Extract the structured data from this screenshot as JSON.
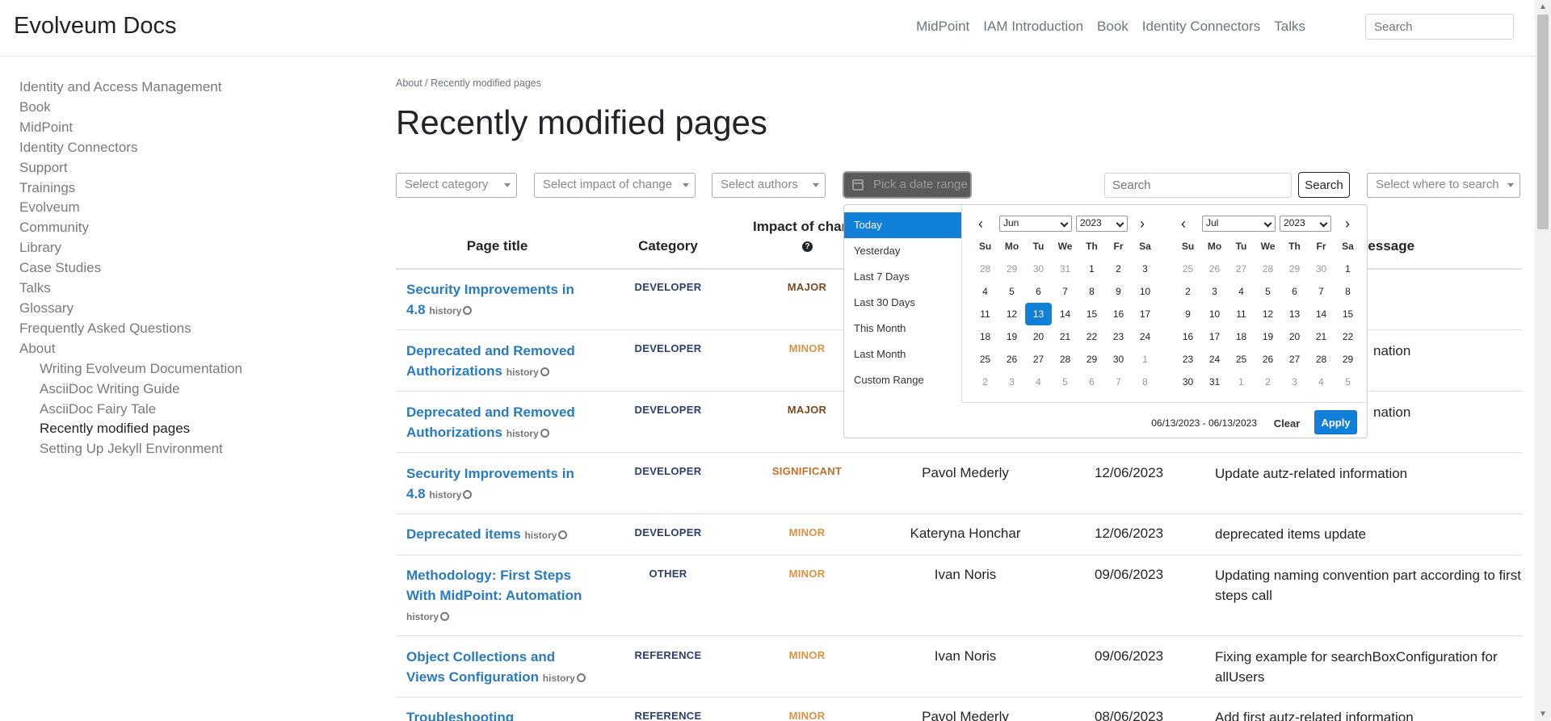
{
  "header": {
    "brand": "Evolveum Docs",
    "nav": [
      "MidPoint",
      "IAM Introduction",
      "Book",
      "Identity Connectors",
      "Talks"
    ],
    "search_placeholder": "Search"
  },
  "sidebar": {
    "items": [
      "Identity and Access Management",
      "Book",
      "MidPoint",
      "Identity Connectors",
      "Support",
      "Trainings",
      "Evolveum",
      "Community",
      "Library",
      "Case Studies",
      "Talks",
      "Glossary",
      "Frequently Asked Questions",
      "About"
    ],
    "subitems": [
      "Writing Evolveum Documentation",
      "AsciiDoc Writing Guide",
      "AsciiDoc Fairy Tale",
      "Recently modified pages",
      "Setting Up Jekyll Environment"
    ]
  },
  "breadcrumb": "About / Recently modified pages",
  "page_title": "Recently modified pages",
  "filters": {
    "category": "Select category",
    "impact": "Select impact of change",
    "authors": "Select authors",
    "date": "Pick a date range",
    "search_placeholder": "Search",
    "search_button": "Search",
    "where": "Select where to search"
  },
  "table": {
    "headers": {
      "title": "Page title",
      "category": "Category",
      "impact_line1": "Impact of chan",
      "impact_icon": "?",
      "message": "nessage"
    },
    "history_label": "history",
    "rows": [
      {
        "title": "Security Improvements in 4.8",
        "category": "DEVELOPER",
        "impact": "MAJOR",
        "author": "",
        "date": "",
        "message": ""
      },
      {
        "title": "Deprecated and Removed Authorizations",
        "category": "DEVELOPER",
        "impact": "MINOR",
        "author": "",
        "date": "",
        "message": "nation"
      },
      {
        "title": "Deprecated and Removed Authorizations",
        "category": "DEVELOPER",
        "impact": "MAJOR",
        "author": "",
        "date": "",
        "message": "nation"
      },
      {
        "title": "Security Improvements in 4.8",
        "category": "DEVELOPER",
        "impact": "SIGNIFICANT",
        "author": "Pavol Mederly",
        "date": "12/06/2023",
        "message": "Update autz-related information"
      },
      {
        "title": "Deprecated items",
        "category": "DEVELOPER",
        "impact": "MINOR",
        "author": "Kateryna Honchar",
        "date": "12/06/2023",
        "message": "deprecated items update"
      },
      {
        "title": "Methodology: First Steps With MidPoint: Automation",
        "category": "OTHER",
        "impact": "MINOR",
        "author": "Ivan Noris",
        "date": "09/06/2023",
        "message": "Updating naming convention part according to first steps call"
      },
      {
        "title": "Object Collections and Views Configuration",
        "category": "REFERENCE",
        "impact": "MINOR",
        "author": "Ivan Noris",
        "date": "09/06/2023",
        "message": "Fixing example for searchBoxConfiguration for allUsers"
      },
      {
        "title": "Troubleshooting",
        "category": "REFERENCE",
        "impact": "MINOR",
        "author": "Pavol Mederly",
        "date": "08/06/2023",
        "message": "Add first autz-related information"
      }
    ]
  },
  "datepicker": {
    "ranges": [
      "Today",
      "Yesterday",
      "Last 7 Days",
      "Last 30 Days",
      "This Month",
      "Last Month",
      "Custom Range"
    ],
    "active_range": "Today",
    "left": {
      "month": "Jun",
      "year": "2023"
    },
    "right": {
      "month": "Jul",
      "year": "2023"
    },
    "dow": [
      "Su",
      "Mo",
      "Tu",
      "We",
      "Th",
      "Fr",
      "Sa"
    ],
    "left_weeks": [
      [
        "28",
        "29",
        "30",
        "31",
        "1",
        "2",
        "3"
      ],
      [
        "4",
        "5",
        "6",
        "7",
        "8",
        "9",
        "10"
      ],
      [
        "11",
        "12",
        "13",
        "14",
        "15",
        "16",
        "17"
      ],
      [
        "18",
        "19",
        "20",
        "21",
        "22",
        "23",
        "24"
      ],
      [
        "25",
        "26",
        "27",
        "28",
        "29",
        "30",
        "1"
      ],
      [
        "2",
        "3",
        "4",
        "5",
        "6",
        "7",
        "8"
      ]
    ],
    "right_weeks": [
      [
        "25",
        "26",
        "27",
        "28",
        "29",
        "30",
        "1"
      ],
      [
        "2",
        "3",
        "4",
        "5",
        "6",
        "7",
        "8"
      ],
      [
        "9",
        "10",
        "11",
        "12",
        "13",
        "14",
        "15"
      ],
      [
        "16",
        "17",
        "18",
        "19",
        "20",
        "21",
        "22"
      ],
      [
        "23",
        "24",
        "25",
        "26",
        "27",
        "28",
        "29"
      ],
      [
        "30",
        "31",
        "1",
        "2",
        "3",
        "4",
        "5"
      ]
    ],
    "selected_label": "06/13/2023 - 06/13/2023",
    "clear": "Clear",
    "apply": "Apply"
  }
}
